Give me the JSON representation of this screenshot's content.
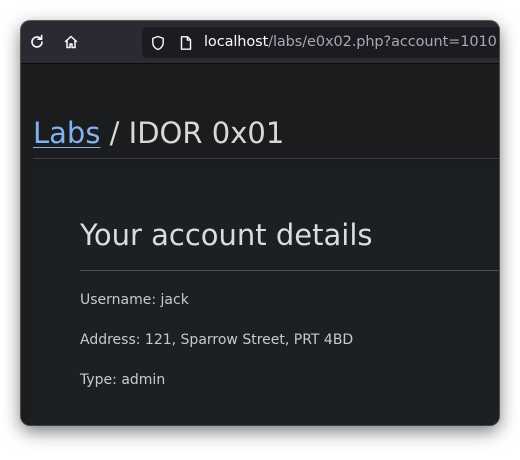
{
  "browser": {
    "url_host": "localhost",
    "url_path": "/labs/e0x02.php?account=1010",
    "icons": {
      "reload": "reload-icon",
      "home": "home-icon",
      "shield": "shield-icon",
      "page": "page-icon"
    }
  },
  "page": {
    "breadcrumb_link": "Labs",
    "breadcrumb_separator": " / ",
    "breadcrumb_current": "IDOR 0x01",
    "card_title": "Your account details",
    "details": [
      "Username: jack",
      "Address: 121, Sparrow Street, PRT 4BD",
      "Type: admin"
    ]
  },
  "colors": {
    "toolbar": "#2b2a33",
    "background": "#1a1c1e",
    "link": "#83b1f0",
    "text": "#d8d8d8"
  }
}
